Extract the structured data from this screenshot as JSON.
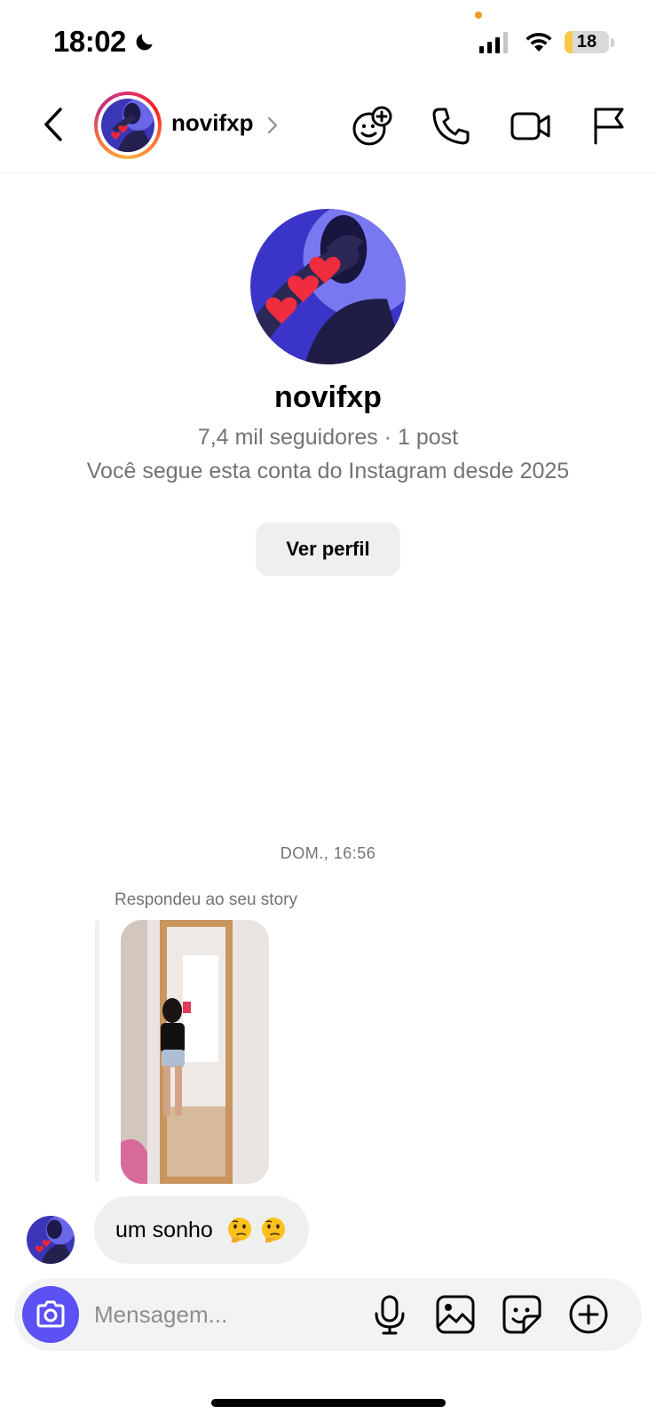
{
  "status_bar": {
    "time": "18:02",
    "battery_level": "18",
    "battery_fraction": 0.18,
    "icons": [
      "moon-icon",
      "cellular-signal-icon",
      "wifi-icon",
      "battery-icon"
    ]
  },
  "header": {
    "username": "novifxp",
    "icons": [
      "back-chevron-icon",
      "chevron-right-icon",
      "add-to-chat-face-icon",
      "phone-icon",
      "video-camera-icon",
      "flag-icon"
    ]
  },
  "profile": {
    "name": "novifxp",
    "stats": "7,4 mil seguidores · 1 post",
    "follow_info": "Você segue esta conta do Instagram desde 2025",
    "view_profile_label": "Ver perfil"
  },
  "conversation": {
    "timestamp": "DOM., 16:56",
    "reply_label": "Respondeu ao seu story",
    "message_text": "um sonho",
    "message_emojis": [
      "thinking-face-emoji",
      "thinking-face-emoji"
    ]
  },
  "composer": {
    "placeholder": "Mensagem...",
    "icons": [
      "camera-icon",
      "microphone-icon",
      "gallery-icon",
      "sticker-icon",
      "plus-circle-icon"
    ]
  },
  "colors": {
    "accent": "#5b51f5",
    "bubble": "#efefef",
    "secondary_text": "#737373"
  }
}
